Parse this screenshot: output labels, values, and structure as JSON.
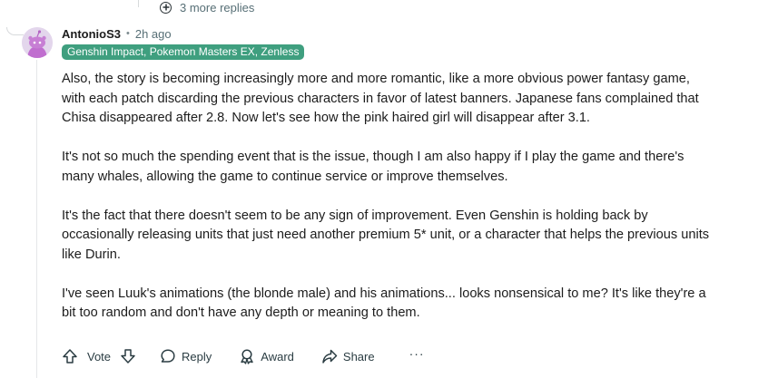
{
  "thread": {
    "more_replies_label": "3 more replies"
  },
  "comment": {
    "username": "AntonioS3",
    "separator": "•",
    "time": "2h ago",
    "flair": "Genshin Impact, Pokemon Masters EX, Zenless",
    "flair_color": "#3f9f7f",
    "paragraphs": [
      "Also, the story is becoming increasingly more and more romantic, like a more obvious power fantasy game, with each patch discarding the previous characters in favor of latest banners. Japanese fans complained that Chisa disappeared after 2.8. Now let's see how the pink haired girl will disappear after 3.1.",
      "It's not so much the spending event that is the issue, though I am also happy if I play the game and there's many whales, allowing the game to continue service or improve themselves.",
      "It's the fact that there doesn't seem to be any sign of improvement. Even Genshin is holding back by occasionally releasing units that just need another premium 5* unit, or a character that helps the previous units like Durin.",
      "I've seen Luuk's animations (the blonde male) and his animations... looks nonsensical to me? It's like they're a bit too random and don't have any depth or meaning to them."
    ]
  },
  "actions": {
    "vote_label": "Vote",
    "reply_label": "Reply",
    "award_label": "Award",
    "share_label": "Share",
    "more_label": "···"
  },
  "icons": {
    "plus_circle": "plus-circle-icon",
    "upvote": "upvote-icon",
    "downvote": "downvote-icon",
    "reply": "speech-bubble-icon",
    "award": "award-icon",
    "share": "share-icon"
  }
}
